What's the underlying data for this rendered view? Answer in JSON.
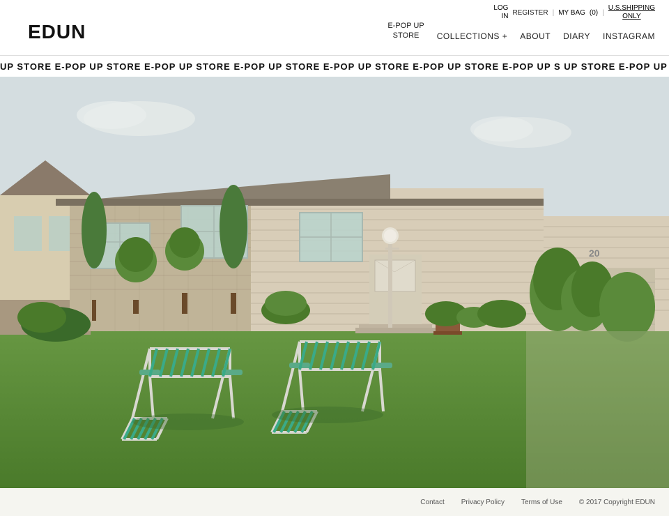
{
  "header": {
    "logo": "EDUN",
    "top_bar": {
      "log_in": "LOG IN",
      "register": "REGISTER",
      "my_bag": "MY BAG",
      "bag_count": "(0)",
      "us_shipping_line1": "U.S.SHIPPING",
      "us_shipping_line2": "ONLY"
    },
    "nav": {
      "epop_line1": "E-POP UP",
      "epop_line2": "STORE",
      "collections": "COLLECTIONS",
      "about": "ABOUT",
      "diary": "DIARY",
      "instagram": "INSTAGRAM"
    }
  },
  "ticker": {
    "items": "UP STORE   E-POP UP STORE   E-POP UP STORE   E-POP UP STORE   E-POP UP STORE   E-POP UP STORE   E-POP UP S   UP STORE   E-POP UP STORE   E-POP UP STORE   E-POP UP STORE   E-POP UP STORE   E-POP UP STORE   E-POP UP S"
  },
  "footer": {
    "contact": "Contact",
    "privacy_policy": "Privacy Policy",
    "terms_of_use": "Terms of Use",
    "copyright": "© 2017 Copyright EDUN"
  },
  "colors": {
    "accent": "#111111",
    "background": "#f5f5f0",
    "header_bg": "#ffffff"
  }
}
